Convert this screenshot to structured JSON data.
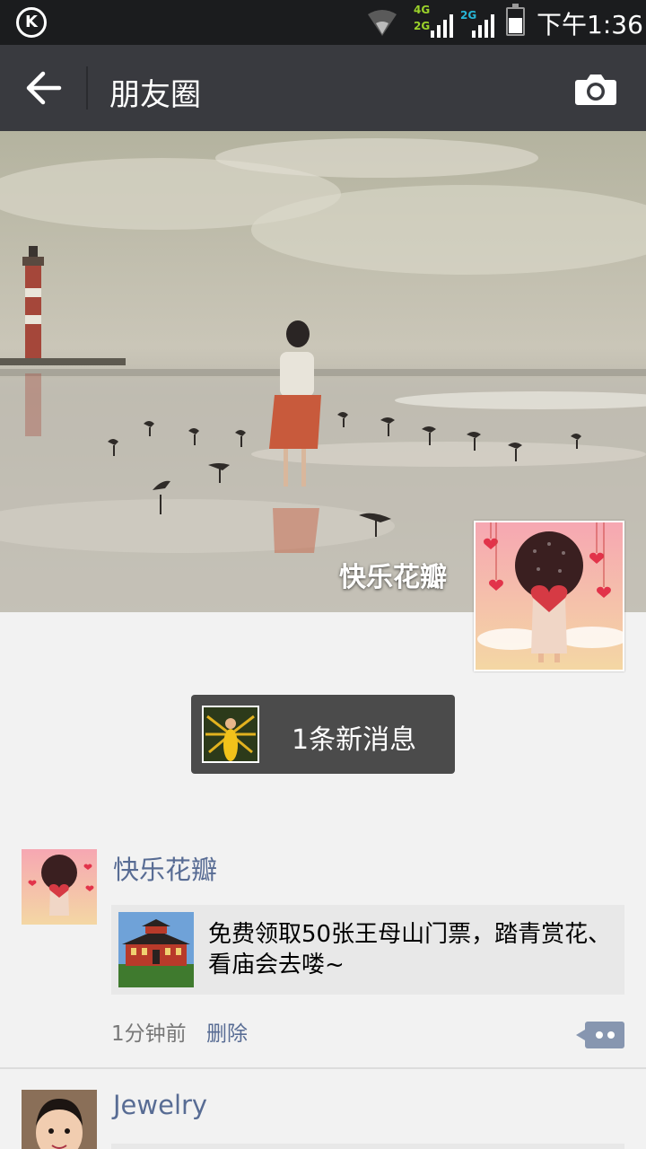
{
  "status_bar": {
    "carrier_logo": "K",
    "net1_top": "4G",
    "net1_bottom": "2G",
    "net2": "2G",
    "time": "下午1:36",
    "icons": [
      "k-logo-icon",
      "wifi-icon",
      "signal-icon",
      "battery-icon"
    ]
  },
  "nav": {
    "back_icon": "back-arrow-icon",
    "title": "朋友圈",
    "camera_icon": "camera-icon"
  },
  "cover": {
    "user_name": "快乐花瓣"
  },
  "new_messages": {
    "label": "1条新消息"
  },
  "posts": [
    {
      "name": "快乐花瓣",
      "share_text": "免费领取50张王母山门票，踏青赏花、看庙会去喽~",
      "time": "1分钟前",
      "delete_label": "删除"
    },
    {
      "name": "Jewelry"
    }
  ],
  "colors": {
    "status_bar": "#1b1c1e",
    "nav_bar": "#393a3f",
    "name_link": "#586c94",
    "background": "#f2f2f2"
  }
}
